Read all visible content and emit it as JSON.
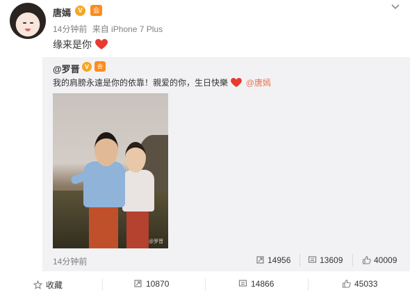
{
  "post": {
    "username": "唐嫣",
    "verified_badge": "V",
    "level_badge": "会",
    "time": "14分钟前",
    "source": "来自 iPhone 7 Plus",
    "text": "缘来是你",
    "icons": {
      "more": "chevron-down-icon",
      "heart": "red-heart-emoji"
    }
  },
  "repost": {
    "username": "@罗晋",
    "verified_badge": "V",
    "level_badge": "会",
    "text": "我的肩膀永遠是你的依靠！親爱的你，生日快樂",
    "mention": "@唐嫣",
    "photo_watermark": "@罗晋",
    "time": "14分钟前",
    "stats": {
      "reposts": "14956",
      "comments": "13609",
      "likes": "40009"
    }
  },
  "toolbar": {
    "favorite_label": "收藏",
    "repost_count": "10870",
    "comment_count": "14866",
    "like_count": "45033"
  },
  "colors": {
    "accent_orange": "#eb7350",
    "heart_red": "#e83a2f",
    "repost_bg": "#f2f2f5"
  }
}
